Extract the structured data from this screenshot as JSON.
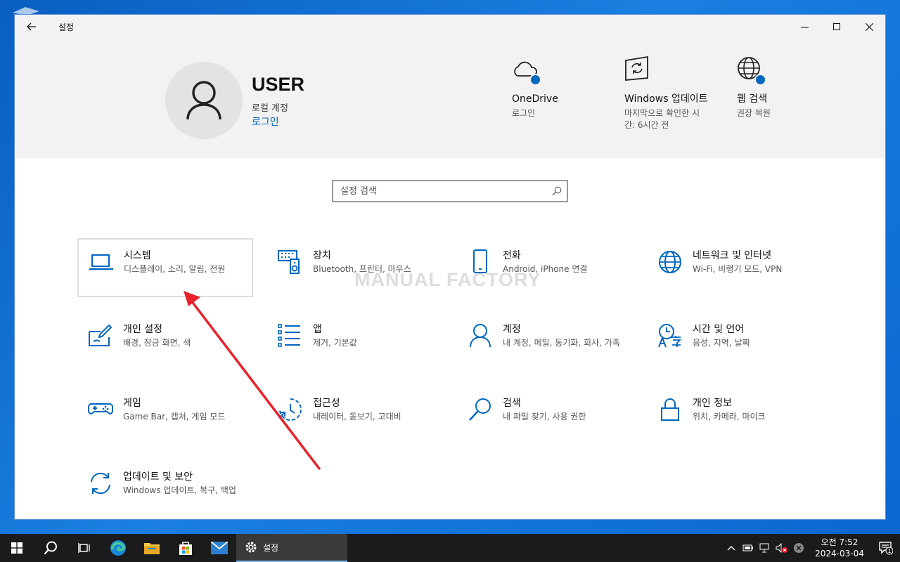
{
  "window": {
    "title": "설정"
  },
  "user": {
    "name": "USER",
    "account_type": "로컬 계정",
    "login_link": "로그인"
  },
  "quick_links": [
    {
      "title": "OneDrive",
      "subtitle": "로그인",
      "icon": "cloud-icon"
    },
    {
      "title": "Windows 업데이트",
      "subtitle": "마지막으로 확인한 시간: 6시간 전",
      "icon": "update-icon"
    },
    {
      "title": "웹 검색",
      "subtitle": "권장 복원",
      "icon": "globe-icon"
    }
  ],
  "search": {
    "placeholder": "설정 검색"
  },
  "watermark": "MANUAL FACTORY",
  "categories": [
    {
      "title": "시스템",
      "subtitle": "디스플레이, 소리, 알림, 전원",
      "icon": "laptop-icon"
    },
    {
      "title": "장치",
      "subtitle": "Bluetooth, 프린터, 마우스",
      "icon": "keyboard-speaker-icon"
    },
    {
      "title": "전화",
      "subtitle": "Android, iPhone 연결",
      "icon": "phone-icon"
    },
    {
      "title": "네트워크 및 인터넷",
      "subtitle": "Wi-Fi, 비행기 모드, VPN",
      "icon": "globe-icon"
    },
    {
      "title": "개인 설정",
      "subtitle": "배경, 잠금 화면, 색",
      "icon": "paint-icon"
    },
    {
      "title": "앱",
      "subtitle": "제거, 기본값",
      "icon": "apps-list-icon"
    },
    {
      "title": "계정",
      "subtitle": "내 계정, 메일, 동기화, 회사, 가족",
      "icon": "person-icon"
    },
    {
      "title": "시간 및 언어",
      "subtitle": "음성, 지역, 날짜",
      "icon": "time-language-icon"
    },
    {
      "title": "게임",
      "subtitle": "Game Bar, 캡처, 게임 모드",
      "icon": "gamepad-icon"
    },
    {
      "title": "접근성",
      "subtitle": "내레이터, 돋보기, 고대비",
      "icon": "accessibility-icon"
    },
    {
      "title": "검색",
      "subtitle": "내 파일 찾기, 사용 권한",
      "icon": "search-icon"
    },
    {
      "title": "개인 정보",
      "subtitle": "위치, 카메라, 마이크",
      "icon": "lock-icon"
    },
    {
      "title": "업데이트 및 보안",
      "subtitle": "Windows 업데이트, 복구, 백업",
      "icon": "sync-icon"
    }
  ],
  "taskbar": {
    "active_app": "설정",
    "time": "오전 7:52",
    "date": "2024-03-04",
    "notification_count": "1"
  },
  "colors": {
    "accent": "#0067c0",
    "arrow": "#e8222b",
    "taskbar": "#1b1b1d"
  }
}
